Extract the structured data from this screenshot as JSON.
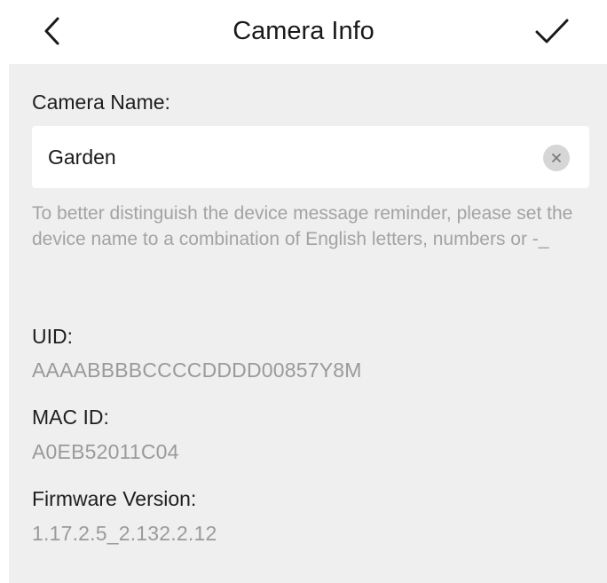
{
  "header": {
    "title": "Camera Info",
    "back_icon": "chevron-left-icon",
    "confirm_icon": "checkmark-icon"
  },
  "camera_name": {
    "label": "Camera Name:",
    "value": "Garden",
    "clear_icon": "clear-x-icon",
    "hint": "To better distinguish the device message reminder, please set the device name to a combination of English letters, numbers or -_"
  },
  "info": {
    "uid_label": "UID:",
    "uid_value": "AAAABBBBCCCCDDDD00857Y8M",
    "mac_label": "MAC ID:",
    "mac_value": "A0EB52011C04",
    "firmware_label": "Firmware Version:",
    "firmware_value": "1.17.2.5_2.132.2.12"
  },
  "colors": {
    "panel_background": "#efefef",
    "label_text": "#1e1e1e",
    "value_text": "#9a9a9a"
  }
}
